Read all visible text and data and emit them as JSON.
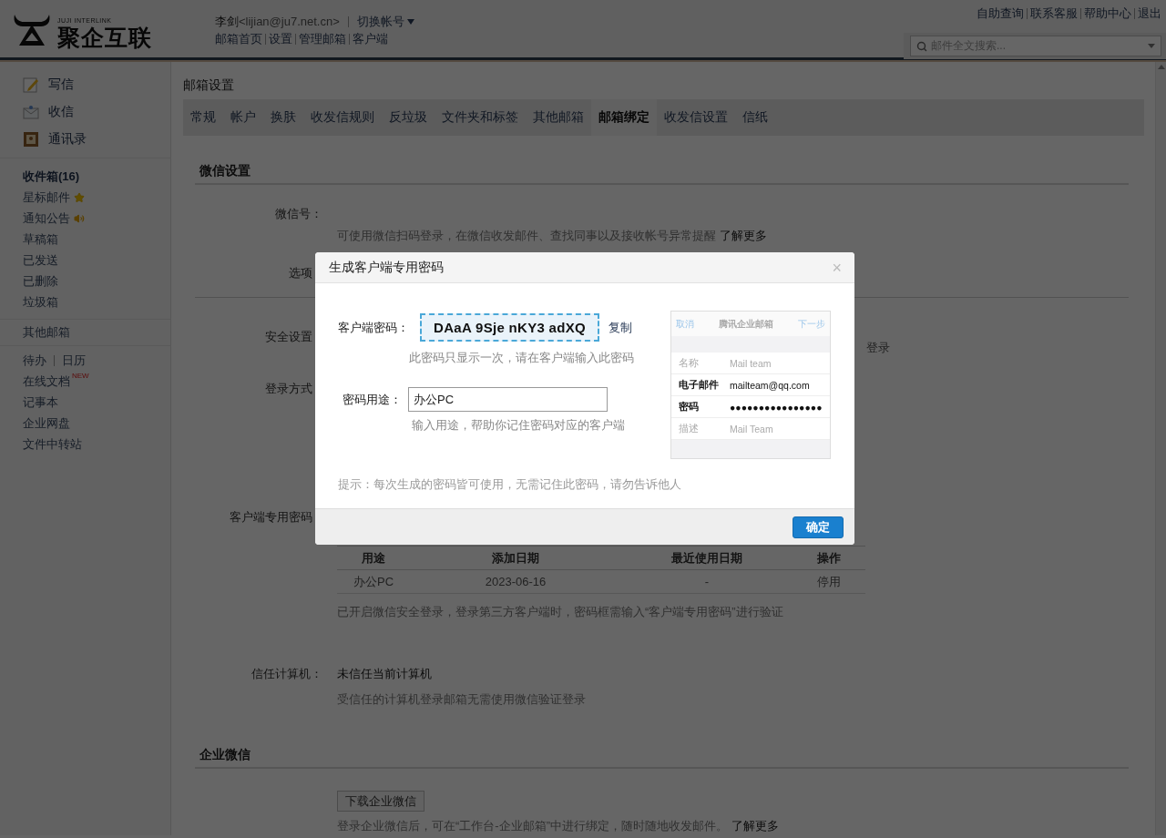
{
  "header": {
    "logo": {
      "tagline": "JUJI INTERLINK",
      "name": "聚企互联"
    },
    "user": {
      "name": "李剑",
      "email": "<lijian@ju7.net.cn>",
      "switch": "切换帐号"
    },
    "nav_links": [
      "邮箱首页",
      "设置",
      "管理邮箱",
      "客户端"
    ],
    "top_links": [
      "自助查询",
      "联系客服",
      "帮助中心",
      "退出"
    ],
    "search": {
      "placeholder": "邮件全文搜索..."
    }
  },
  "sidebar": {
    "actions": [
      {
        "kind": "compose",
        "label": "写信"
      },
      {
        "kind": "inbox",
        "label": "收信"
      },
      {
        "kind": "contacts",
        "label": "通讯录"
      }
    ],
    "folders": [
      {
        "kind": "primary",
        "label": "收件箱(16)"
      },
      {
        "kind": "star",
        "label": "星标邮件"
      },
      {
        "kind": "notice",
        "label": "通知公告"
      },
      {
        "kind": "plain",
        "label": "草稿箱"
      },
      {
        "kind": "plain",
        "label": "已发送"
      },
      {
        "kind": "plain",
        "label": "已删除"
      },
      {
        "kind": "plain",
        "label": "垃圾箱"
      }
    ],
    "other": "其他邮箱",
    "tools_row": [
      "待办",
      "日历"
    ],
    "tools": [
      {
        "label": "在线文档",
        "badge": "NEW"
      },
      {
        "label": "记事本"
      },
      {
        "label": "企业网盘"
      },
      {
        "label": "文件中转站"
      }
    ]
  },
  "main": {
    "title": "邮箱设置",
    "tabs": [
      {
        "label": "常规",
        "selected": false
      },
      {
        "label": "帐户",
        "selected": false
      },
      {
        "label": "换肤",
        "selected": false
      },
      {
        "label": "收发信规则",
        "selected": false
      },
      {
        "label": "反垃圾",
        "selected": false
      },
      {
        "label": "文件夹和标签",
        "selected": false
      },
      {
        "label": "其他邮箱",
        "selected": false
      },
      {
        "label": "邮箱绑定",
        "selected": true
      },
      {
        "label": "收发信设置",
        "selected": false
      },
      {
        "label": "信纸",
        "selected": false
      }
    ],
    "wechat": {
      "title": "微信设置",
      "wechat_id": {
        "label": "微信号：",
        "desc": "可使用微信扫码登录，在微信收发邮件、查找同事以及接收帐号异常提醒",
        "link": "了解更多"
      },
      "options": {
        "label": "选项"
      },
      "security": {
        "label": "安全设置",
        "tail": "登录"
      },
      "login_method": {
        "label": "登录方式"
      },
      "client_password": {
        "label": "客户端专用密码",
        "table": {
          "columns": [
            "用途",
            "添加日期",
            "最近使用日期",
            "操作"
          ],
          "rows": [
            [
              "办公PC",
              "2023-06-16",
              "-",
              "停用"
            ]
          ]
        },
        "note": "已开启微信安全登录，登录第三方客户端时，密码框需输入“客户端专用密码”进行验证"
      },
      "trusted": {
        "label": "信任计算机：",
        "value": "未信任当前计算机",
        "note": "受信任的计算机登录邮箱无需使用微信验证登录"
      }
    },
    "work_wechat": {
      "title": "企业微信",
      "button": "下载企业微信",
      "desc": "登录企业微信后，可在“工作台-企业邮箱”中进行绑定，随时随地收发邮件。",
      "link": "了解更多"
    }
  },
  "dialog": {
    "title": "生成客户端专用密码",
    "close": "×",
    "password_label": "客户端密码：",
    "password": "DAaA 9Sje nKY3 adXQ",
    "copy": "复制",
    "password_hint": "此密码只显示一次，请在客户端输入此密码",
    "purpose_label": "密码用途：",
    "purpose_value": "办公PC",
    "purpose_hint": "输入用途，帮助你记住密码对应的客户端",
    "tip": "提示：每次生成的密码皆可使用，无需记住此密码，请勿告诉他人",
    "confirm": "确定",
    "preview": {
      "cancel": "取消",
      "title": "腾讯企业邮箱",
      "next": "下一步",
      "rows": [
        {
          "label": "名称",
          "value": "Mail team",
          "emphasis": false
        },
        {
          "label": "电子邮件",
          "value": "mailteam@qq.com",
          "emphasis": true
        },
        {
          "label": "密码",
          "value": "●●●●●●●●●●●●●●●●",
          "emphasis": true
        },
        {
          "label": "描述",
          "value": "Mail Team",
          "emphasis": false
        }
      ]
    }
  }
}
